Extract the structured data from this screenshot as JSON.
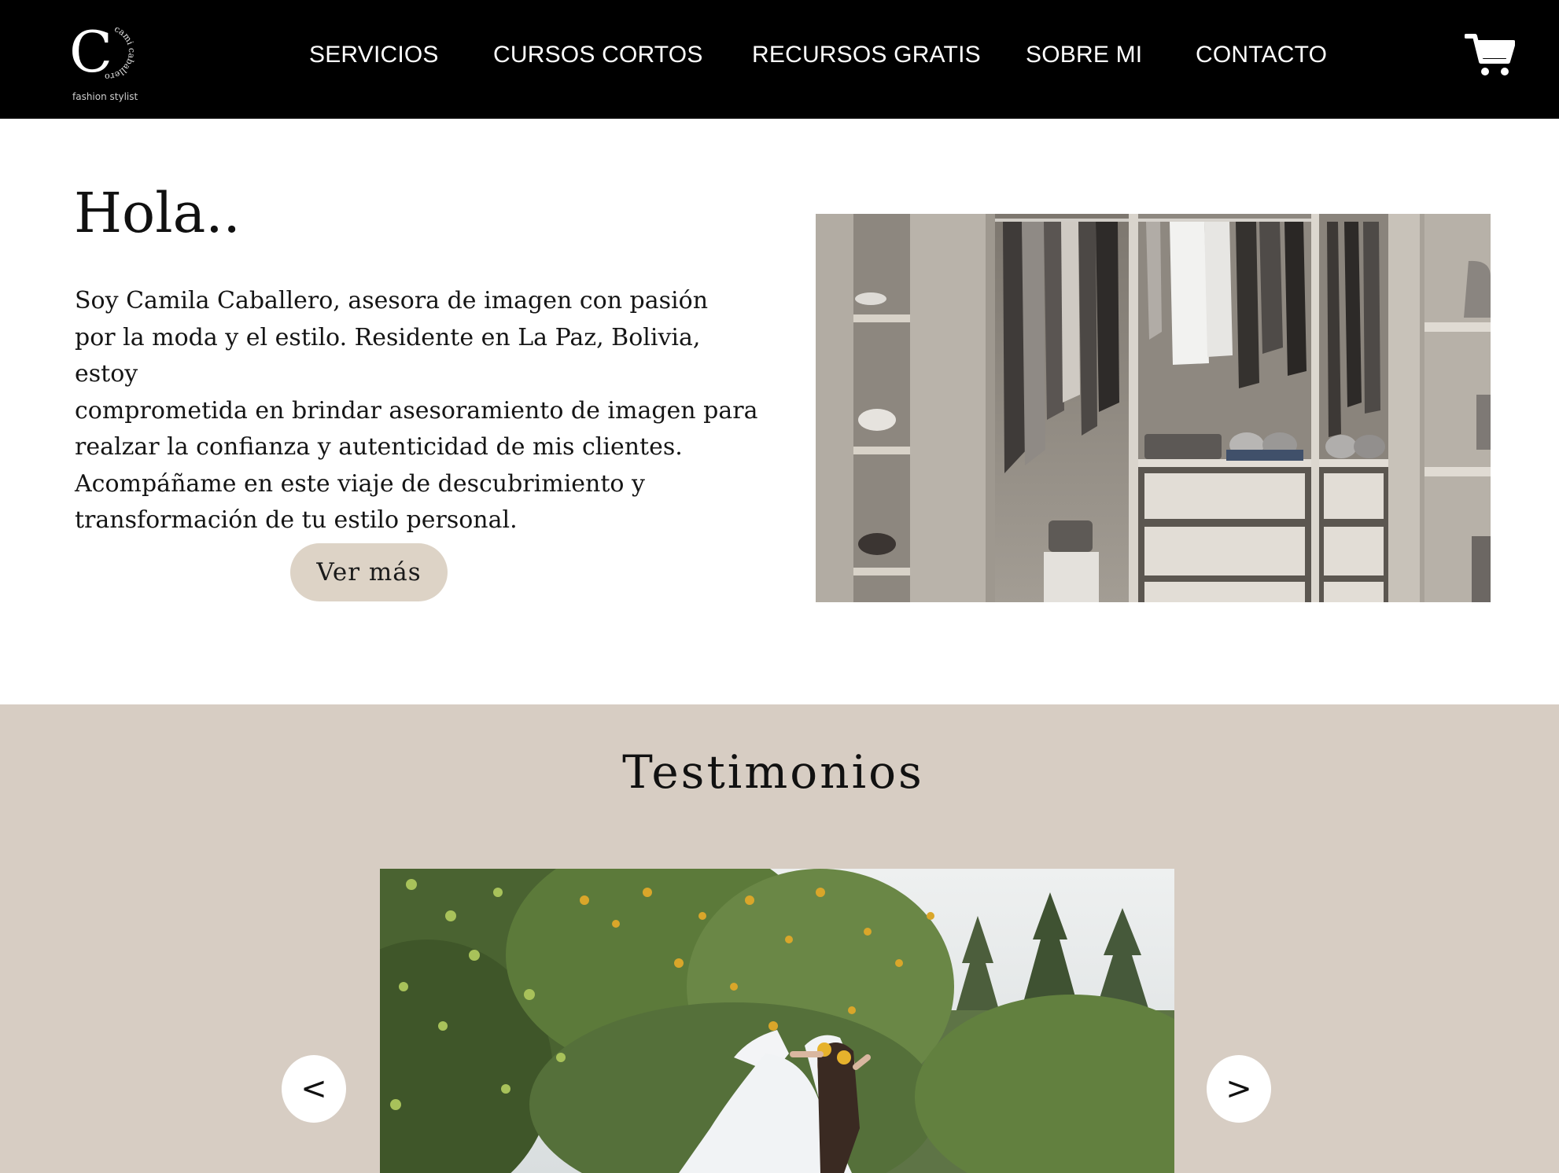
{
  "brand": {
    "logo_letter": "C",
    "logo_ring_text": "cami caballero",
    "tagline": "fashion stylist"
  },
  "nav": {
    "items": [
      {
        "label": "SERVICIOS"
      },
      {
        "label": "CURSOS CORTOS"
      },
      {
        "label": "RECURSOS GRATIS"
      },
      {
        "label": "SOBRE MI"
      },
      {
        "label": "CONTACTO"
      }
    ],
    "cart_icon": "shopping-cart-icon"
  },
  "intro": {
    "title": "Hola..",
    "paragraph_lines": [
      "Soy Camila Caballero, asesora de imagen con pasión",
      "por la moda y el estilo. Residente en La Paz, Bolivia, estoy",
      "comprometida en brindar asesoramiento de imagen para",
      "realzar la confianza y autenticidad de mis clientes.",
      "Acompáñame en este viaje de descubrimiento y",
      "transformación de tu estilo personal."
    ],
    "button_label": "Ver más"
  },
  "testimonials": {
    "title": "Testimonios",
    "prev_label": "<",
    "next_label": ">"
  },
  "colors": {
    "header_bg": "#000000",
    "button_bg": "#ddd3c6",
    "section_bg": "#d7cdc3"
  }
}
